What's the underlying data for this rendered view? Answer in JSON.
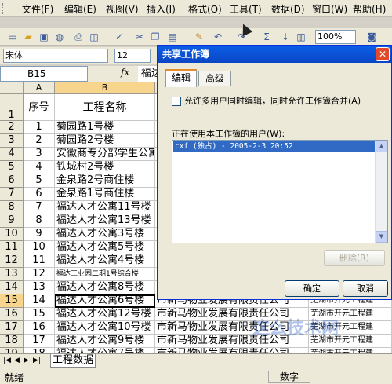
{
  "menu": [
    "文件(F)",
    "编辑(E)",
    "视图(V)",
    "插入(I)",
    "格式(O)",
    "工具(T)",
    "数据(D)",
    "窗口(W)",
    "帮助(H)"
  ],
  "toolbar": {
    "zoom": "100%"
  },
  "format_bar": {
    "font": "宋体",
    "size": "12"
  },
  "formula_bar": {
    "name_box": "B15",
    "fx": "fx",
    "value": "福达"
  },
  "columns": [
    "A",
    "B"
  ],
  "header_row": {
    "row": "1",
    "seq": "序号",
    "name": "工程名称"
  },
  "rows": [
    {
      "row": "2",
      "seq": "1",
      "name": "菊园路1号楼",
      "c": "",
      "d": ""
    },
    {
      "row": "3",
      "seq": "2",
      "name": "菊园路2号楼",
      "c": "",
      "d": ""
    },
    {
      "row": "4",
      "seq": "3",
      "name": "安徽商专分部学生公寓",
      "c": "",
      "d": ""
    },
    {
      "row": "5",
      "seq": "4",
      "name": "铁城村2号楼",
      "c": "",
      "d": ""
    },
    {
      "row": "6",
      "seq": "5",
      "name": "金泉路2号商住楼",
      "c": "",
      "d": ""
    },
    {
      "row": "7",
      "seq": "6",
      "name": "金泉路1号商住楼",
      "c": "",
      "d": ""
    },
    {
      "row": "8",
      "seq": "7",
      "name": "福达人才公寓11号楼",
      "c": "",
      "d": ""
    },
    {
      "row": "9",
      "seq": "8",
      "name": "福达人才公寓13号楼",
      "c": "",
      "d": ""
    },
    {
      "row": "10",
      "seq": "9",
      "name": "福达人才公寓3号楼",
      "c": "",
      "d": ""
    },
    {
      "row": "11",
      "seq": "10",
      "name": "福达人才公寓5号楼",
      "c": "",
      "d": ""
    },
    {
      "row": "12",
      "seq": "11",
      "name": "福达人才公寓4号楼",
      "c": "",
      "d": ""
    },
    {
      "row": "13",
      "seq": "12",
      "name": "福达工业园二期1号综合楼",
      "c": "",
      "d": ""
    },
    {
      "row": "14",
      "seq": "13",
      "name": "福达人才公寓8号楼",
      "c": "",
      "d": ""
    },
    {
      "row": "15",
      "seq": "14",
      "name": "福达人才公寓6号楼",
      "c": "市新马物业发展有限责任公司",
      "d": "芜湖市开元工程建"
    },
    {
      "row": "16",
      "seq": "15",
      "name": "福达人才公寓12号楼",
      "c": "市新马物业发展有限责任公司",
      "d": "芜湖市开元工程建"
    },
    {
      "row": "17",
      "seq": "16",
      "name": "福达人才公寓10号楼",
      "c": "市新马物业发展有限责任公司",
      "d": "芜湖市开元工程建"
    },
    {
      "row": "18",
      "seq": "17",
      "name": "福达人才公寓9号楼",
      "c": "市新马物业发展有限责任公司",
      "d": "芜湖市开元工程建"
    },
    {
      "row": "19",
      "seq": "18",
      "name": "福达人才公寓7号楼",
      "c": "市新马物业发展有限责任公司",
      "d": "芜湖市开元工程建"
    }
  ],
  "sheet_tab": "工程数据",
  "status": {
    "ready": "就绪",
    "mode": "数字"
  },
  "dialog": {
    "title": "共享工作簿",
    "tabs": [
      "编辑",
      "高级"
    ],
    "checkbox_label": "允许多用户同时编辑，同时允许工作簿合并(A)",
    "users_label": "正在使用本工作簿的用户(W):",
    "users": [
      "cxf (独占) - 2005-2-3 20:52"
    ],
    "remove_button": "删除(R)",
    "ok_button": "确定",
    "cancel_button": "取消"
  },
  "watermark": "这么技术网"
}
